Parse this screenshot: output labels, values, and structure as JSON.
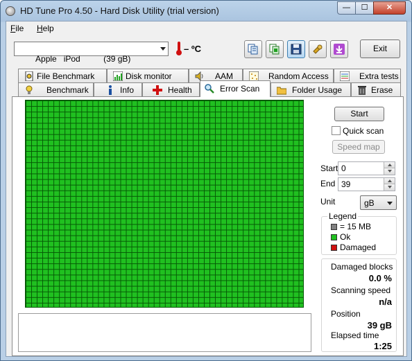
{
  "window": {
    "title": "HD Tune Pro 4.50 - Hard Disk Utility (trial version)",
    "close_glyph": "✕",
    "minimize_glyph": "—",
    "maximize_glyph": "☐"
  },
  "menu": [
    {
      "label": "File",
      "accel": "F",
      "rest": "ile"
    },
    {
      "label": "Help",
      "accel": "H",
      "rest": "elp"
    }
  ],
  "toolbar": {
    "drive": "Apple   iPod          (39 gB)",
    "temperature": "– ºC",
    "exit_label": "Exit",
    "icons": [
      "copy-info-icon",
      "copy-screenshot-icon",
      "save-icon",
      "options-icon",
      "download-icon"
    ]
  },
  "tabs_row1": [
    {
      "label": "File Benchmark",
      "icon": "file-benchmark-icon"
    },
    {
      "label": "Disk monitor",
      "icon": "disk-monitor-icon"
    },
    {
      "label": "AAM",
      "icon": "speaker-icon"
    },
    {
      "label": "Random Access",
      "icon": "random-access-icon"
    },
    {
      "label": "Extra tests",
      "icon": "extra-tests-icon"
    }
  ],
  "tabs_row2": [
    {
      "label": "Benchmark",
      "icon": "benchmark-icon"
    },
    {
      "label": "Info",
      "icon": "info-icon"
    },
    {
      "label": "Health",
      "icon": "health-icon"
    },
    {
      "label": "Error Scan",
      "icon": "magnifier-icon",
      "active": true
    },
    {
      "label": "Folder Usage",
      "icon": "folder-icon"
    },
    {
      "label": "Erase",
      "icon": "trash-icon"
    }
  ],
  "controls": {
    "start_label": "Start",
    "quick_scan_label": "Quick scan",
    "quick_scan_checked": false,
    "speed_map_label": "Speed map",
    "start_field_label": "Start",
    "start_value": "0",
    "end_field_label": "End",
    "end_value": "39",
    "unit_label": "Unit",
    "unit_value": "gB"
  },
  "legend": {
    "title": "Legend",
    "items": [
      {
        "label": "= 15 MB",
        "color": "#808080"
      },
      {
        "label": "Ok",
        "color": "#20c020"
      },
      {
        "label": "Damaged",
        "color": "#d01010"
      }
    ]
  },
  "stats": {
    "damaged_label": "Damaged blocks",
    "damaged_value": "0.0 %",
    "speed_label": "Scanning speed",
    "speed_value": "n/a",
    "position_label": "Position",
    "position_value": "39 gB",
    "elapsed_label": "Elapsed time",
    "elapsed_value": "1:25"
  },
  "colors": {
    "ok_block": "#20c020",
    "grid_line": "#055805",
    "damaged": "#d01010"
  }
}
